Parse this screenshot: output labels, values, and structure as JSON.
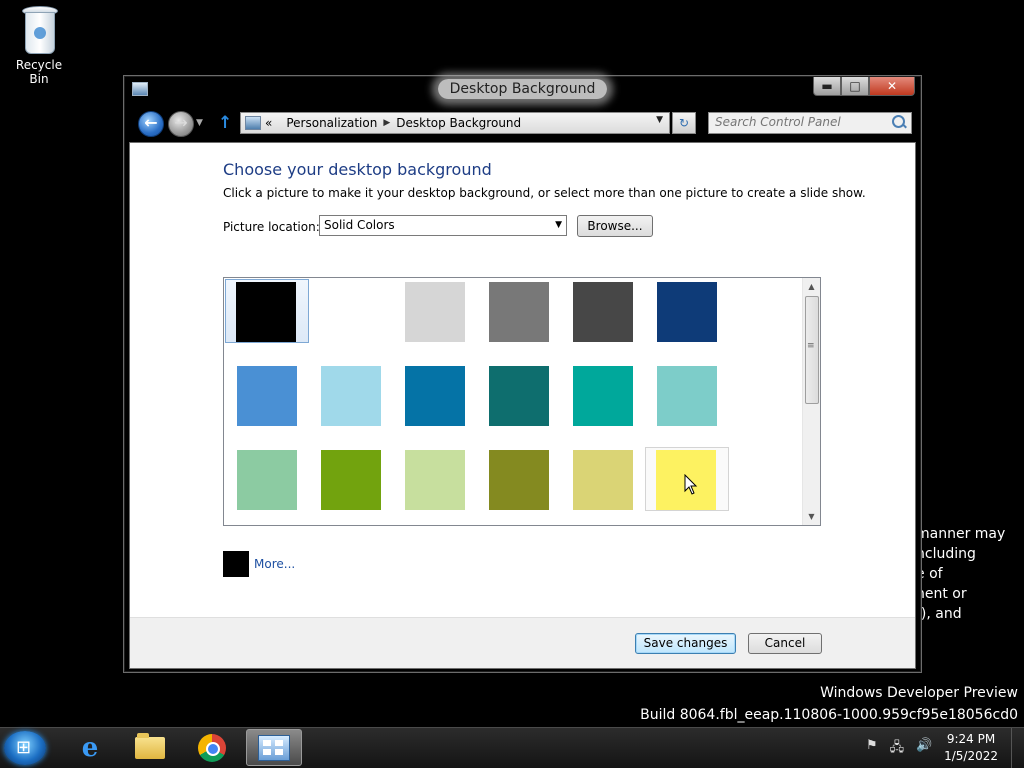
{
  "desktop": {
    "recycle_bin_label": "Recycle Bin",
    "watermark_line1": "Windows Developer Preview",
    "watermark_line2": "Build 8064.fbl_eeap.110806-1000.959cf95e18056cd0",
    "legal_lines": [
      "manner may",
      "ncluding",
      "e of",
      "nent or",
      "f), and"
    ]
  },
  "window": {
    "title": "Desktop Background",
    "controls": {
      "minimize": "▬",
      "maximize": "□",
      "close": "✕"
    }
  },
  "navigation": {
    "back_icon": "back-arrow-icon",
    "forward_icon": "forward-arrow-icon",
    "up_icon": "up-arrow-icon",
    "breadcrumb_overflow": "«",
    "breadcrumb": [
      "Personalization",
      "Desktop Background"
    ],
    "search_placeholder": "Search Control Panel"
  },
  "page": {
    "heading": "Choose your desktop background",
    "description": "Click a picture to make it your desktop background, or select more than one picture to create a slide show.",
    "picture_location_label": "Picture location:",
    "picture_location_value": "Solid Colors",
    "browse_label": "Browse...",
    "more_label": "More...",
    "more_color": "#000000"
  },
  "swatches": [
    {
      "color": "#000000",
      "state": "selected"
    },
    {
      "color": "#ffffff",
      "state": ""
    },
    {
      "color": "#d6d6d6",
      "state": ""
    },
    {
      "color": "#787878",
      "state": ""
    },
    {
      "color": "#474747",
      "state": ""
    },
    {
      "color": "#0e3b78",
      "state": ""
    },
    {
      "color": "#4a90d4",
      "state": ""
    },
    {
      "color": "#a0d9ea",
      "state": ""
    },
    {
      "color": "#0573a6",
      "state": ""
    },
    {
      "color": "#0e6e6e",
      "state": ""
    },
    {
      "color": "#00a89b",
      "state": ""
    },
    {
      "color": "#7dcdc9",
      "state": ""
    },
    {
      "color": "#8ccba2",
      "state": ""
    },
    {
      "color": "#72a30e",
      "state": ""
    },
    {
      "color": "#c7df9e",
      "state": ""
    },
    {
      "color": "#848a20",
      "state": ""
    },
    {
      "color": "#dad475",
      "state": ""
    },
    {
      "color": "#fdf261",
      "state": "hover"
    }
  ],
  "footer": {
    "save_label": "Save changes",
    "cancel_label": "Cancel"
  },
  "taskbar": {
    "pinned": [
      "internet-explorer-icon",
      "file-explorer-icon",
      "chrome-icon",
      "control-panel-icon"
    ],
    "tray_icons": [
      "flag-icon",
      "network-icon",
      "volume-icon"
    ],
    "time": "9:24 PM",
    "date": "1/5/2022"
  }
}
